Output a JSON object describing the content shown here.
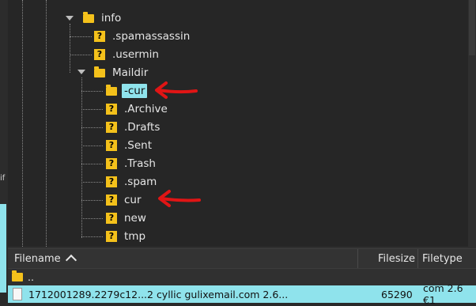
{
  "tree": {
    "nodes": [
      {
        "name": "info",
        "icon": "folder",
        "expanded": true
      },
      {
        "name": ".spamassassin",
        "icon": "unknown"
      },
      {
        "name": ".usermin",
        "icon": "unknown"
      },
      {
        "name": "Maildir",
        "icon": "folder",
        "expanded": true
      },
      {
        "name": "-cur",
        "icon": "folder",
        "selected": true
      },
      {
        "name": ".Archive",
        "icon": "unknown"
      },
      {
        "name": ".Drafts",
        "icon": "unknown"
      },
      {
        "name": ".Sent",
        "icon": "unknown"
      },
      {
        "name": ".Trash",
        "icon": "unknown"
      },
      {
        "name": ".spam",
        "icon": "unknown"
      },
      {
        "name": "cur",
        "icon": "unknown"
      },
      {
        "name": "new",
        "icon": "unknown"
      },
      {
        "name": "tmp",
        "icon": "unknown"
      }
    ]
  },
  "file_list": {
    "columns": {
      "filename": "Filename",
      "filesize": "Filesize",
      "filetype": "Filetype"
    },
    "rows": [
      {
        "name": "..",
        "size": "",
        "type": ""
      },
      {
        "name": "1712001289.2279c12...2 cyllic gulixemail.com 2.6...",
        "size": "65290",
        "type": "com 2.6 €1"
      }
    ]
  },
  "colors": {
    "accent_selection": "#8fe3ec",
    "folder": "#f4c11b",
    "annotation_arrow": "#e01515"
  },
  "icons": [
    "folder-icon",
    "unknown-file-icon",
    "sort-ascending-icon",
    "red-annotation-arrow"
  ]
}
